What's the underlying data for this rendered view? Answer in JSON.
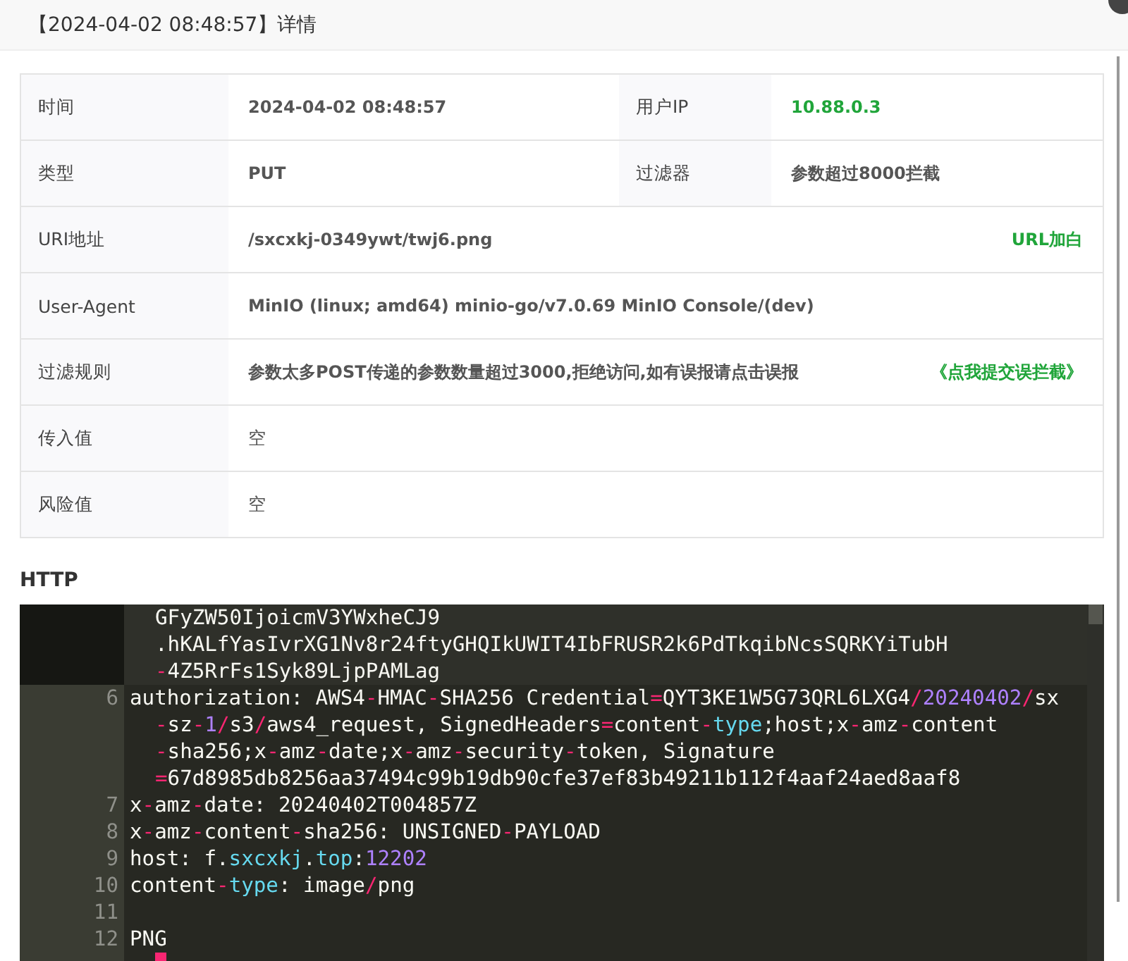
{
  "dialog": {
    "title": "【2024-04-02 08:48:57】详情"
  },
  "details": {
    "rows": [
      {
        "kind": "pair",
        "label": "时间",
        "value": "2024-04-02 08:48:57",
        "label2": "用户IP",
        "value2": "10.88.0.3"
      },
      {
        "kind": "pair",
        "label": "类型",
        "value": "PUT",
        "label2": "过滤器",
        "value2": "参数超过8000拦截"
      },
      {
        "kind": "wide",
        "label": "URI地址",
        "value": "/sxcxkj-0349ywt/twj6.png",
        "action": "URL加白"
      },
      {
        "kind": "wide",
        "label": "User-Agent",
        "value": "MinIO (linux; amd64) minio-go/v7.0.69 MinIO Console/(dev)"
      },
      {
        "kind": "wide",
        "label": "过滤规则",
        "value": "参数太多POST传递的参数数量超过3000,拒绝访问,如有误报请点击误报",
        "action": "《点我提交误拦截》"
      },
      {
        "kind": "empty",
        "label": "传入值",
        "value": "空"
      },
      {
        "kind": "empty",
        "label": "风险值",
        "value": "空"
      }
    ]
  },
  "http": {
    "heading": "HTTP",
    "lines": [
      {
        "active": true,
        "segments": [
          {
            "kind": "text",
            "text": "GFyZW50IjoicmV3YWxheCJ9"
          }
        ]
      },
      {
        "active": true,
        "segments": [
          {
            "kind": "text",
            "text": ".hKALfYasIvrXG1Nv8r24ftyGHQIkUWIT4IbFRUSR2k6PdTkqibNcsSQRKYiTubH"
          }
        ]
      },
      {
        "active": true,
        "segments": [
          {
            "kind": "op",
            "text": "-"
          },
          {
            "kind": "text",
            "text": "4Z5RrFs1Syk89LjpPAMLag"
          }
        ]
      },
      {
        "number": "6",
        "active": false,
        "segments": [
          {
            "kind": "text",
            "text": "authorization: AWS4"
          },
          {
            "kind": "op",
            "text": "-"
          },
          {
            "kind": "text",
            "text": "HMAC"
          },
          {
            "kind": "op",
            "text": "-"
          },
          {
            "kind": "text",
            "text": "SHA256 Credential"
          },
          {
            "kind": "op",
            "text": "="
          },
          {
            "kind": "text",
            "text": "QYT3KE1W5G73QRL6LXG4"
          },
          {
            "kind": "op",
            "text": "/"
          },
          {
            "kind": "number",
            "text": "20240402"
          },
          {
            "kind": "op",
            "text": "/"
          },
          {
            "kind": "text",
            "text": "sx"
          }
        ]
      },
      {
        "active": false,
        "segments": [
          {
            "kind": "op",
            "text": "-"
          },
          {
            "kind": "text",
            "text": "sz"
          },
          {
            "kind": "op",
            "text": "-"
          },
          {
            "kind": "number",
            "text": "1"
          },
          {
            "kind": "op",
            "text": "/"
          },
          {
            "kind": "text",
            "text": "s3"
          },
          {
            "kind": "op",
            "text": "/"
          },
          {
            "kind": "text",
            "text": "aws4_request, SignedHeaders"
          },
          {
            "kind": "op",
            "text": "="
          },
          {
            "kind": "text",
            "text": "content"
          },
          {
            "kind": "op",
            "text": "-"
          },
          {
            "kind": "keyword",
            "text": "type"
          },
          {
            "kind": "text",
            "text": ";host;x"
          },
          {
            "kind": "op",
            "text": "-"
          },
          {
            "kind": "text",
            "text": "amz"
          },
          {
            "kind": "op",
            "text": "-"
          },
          {
            "kind": "text",
            "text": "content"
          }
        ]
      },
      {
        "active": false,
        "segments": [
          {
            "kind": "op",
            "text": "-"
          },
          {
            "kind": "text",
            "text": "sha256;x"
          },
          {
            "kind": "op",
            "text": "-"
          },
          {
            "kind": "text",
            "text": "amz"
          },
          {
            "kind": "op",
            "text": "-"
          },
          {
            "kind": "text",
            "text": "date;x"
          },
          {
            "kind": "op",
            "text": "-"
          },
          {
            "kind": "text",
            "text": "amz"
          },
          {
            "kind": "op",
            "text": "-"
          },
          {
            "kind": "text",
            "text": "security"
          },
          {
            "kind": "op",
            "text": "-"
          },
          {
            "kind": "text",
            "text": "token, Signature"
          }
        ]
      },
      {
        "active": false,
        "segments": [
          {
            "kind": "op",
            "text": "="
          },
          {
            "kind": "text",
            "text": "67d8985db8256aa37494c99b19db90cfe37ef83b49211b112f4aaf24aed8aaf8"
          }
        ]
      },
      {
        "number": "7",
        "active": false,
        "segments": [
          {
            "kind": "text",
            "text": "x"
          },
          {
            "kind": "op",
            "text": "-"
          },
          {
            "kind": "text",
            "text": "amz"
          },
          {
            "kind": "op",
            "text": "-"
          },
          {
            "kind": "text",
            "text": "date: 20240402T004857Z"
          }
        ]
      },
      {
        "number": "8",
        "active": false,
        "segments": [
          {
            "kind": "text",
            "text": "x"
          },
          {
            "kind": "op",
            "text": "-"
          },
          {
            "kind": "text",
            "text": "amz"
          },
          {
            "kind": "op",
            "text": "-"
          },
          {
            "kind": "text",
            "text": "content"
          },
          {
            "kind": "op",
            "text": "-"
          },
          {
            "kind": "text",
            "text": "sha256: UNSIGNED"
          },
          {
            "kind": "op",
            "text": "-"
          },
          {
            "kind": "text",
            "text": "PAYLOAD"
          }
        ]
      },
      {
        "number": "9",
        "active": false,
        "segments": [
          {
            "kind": "text",
            "text": "host: f."
          },
          {
            "kind": "keyword",
            "text": "sxcxkj"
          },
          {
            "kind": "text",
            "text": "."
          },
          {
            "kind": "keyword",
            "text": "top"
          },
          {
            "kind": "text",
            "text": ":"
          },
          {
            "kind": "number",
            "text": "12202"
          }
        ]
      },
      {
        "number": "10",
        "active": false,
        "segments": [
          {
            "kind": "text",
            "text": "content"
          },
          {
            "kind": "op",
            "text": "-"
          },
          {
            "kind": "keyword",
            "text": "type"
          },
          {
            "kind": "text",
            "text": ": image"
          },
          {
            "kind": "op",
            "text": "/"
          },
          {
            "kind": "text",
            "text": "png"
          }
        ]
      },
      {
        "number": "11",
        "active": false
      },
      {
        "number": "12",
        "active": false,
        "segments": [
          {
            "kind": "text",
            "text": "PNG"
          }
        ]
      },
      {
        "active": false,
        "cursor": true
      }
    ]
  }
}
